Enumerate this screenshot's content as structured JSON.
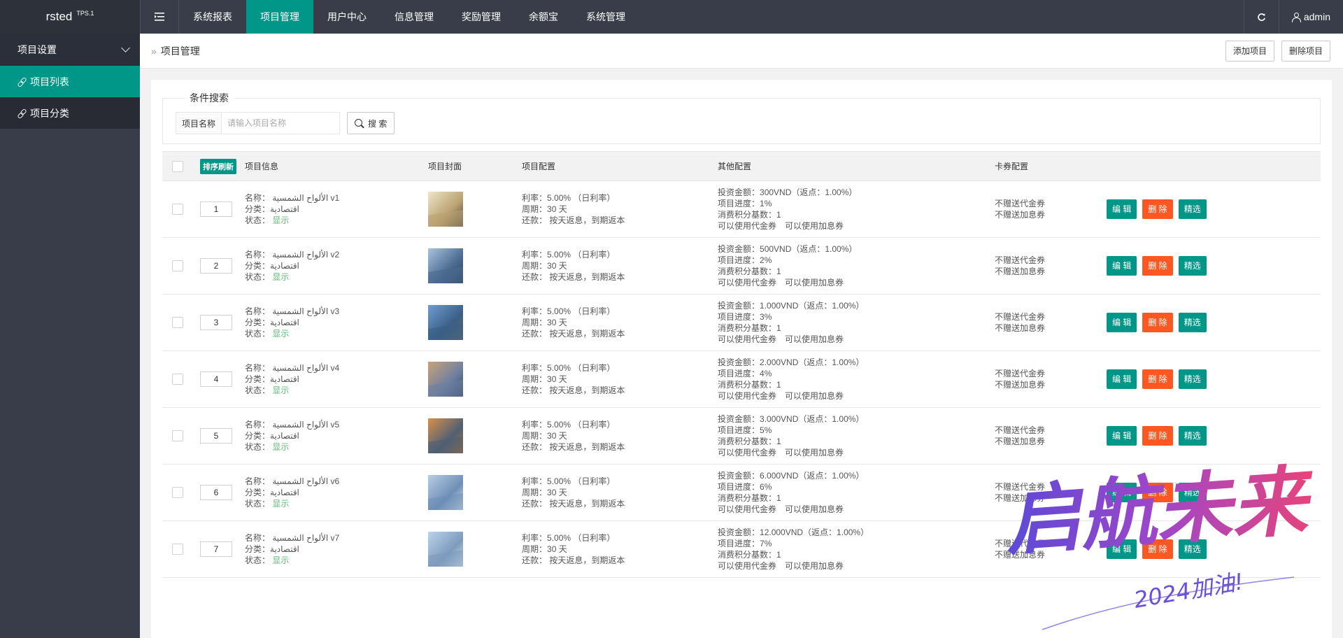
{
  "brand": {
    "name": "rsted",
    "version": "TPS.1"
  },
  "topnav": {
    "items": [
      {
        "label": "系统报表",
        "active": false
      },
      {
        "label": "项目管理",
        "active": true
      },
      {
        "label": "用户中心",
        "active": false
      },
      {
        "label": "信息管理",
        "active": false
      },
      {
        "label": "奖励管理",
        "active": false
      },
      {
        "label": "余额宝",
        "active": false
      },
      {
        "label": "系统管理",
        "active": false
      }
    ],
    "user": "admin",
    "refresh_icon": "refresh-icon"
  },
  "sidebar": {
    "group": "项目设置",
    "items": [
      {
        "label": "项目列表",
        "active": true
      },
      {
        "label": "项目分类",
        "active": false
      }
    ]
  },
  "breadcrumb": {
    "sep": "»",
    "title": "项目管理",
    "add_label": "添加项目",
    "delete_label": "删除项目"
  },
  "search": {
    "legend": "条件搜索",
    "label": "项目名称",
    "placeholder": "请输入项目名称",
    "button": "搜 索"
  },
  "table": {
    "headers": {
      "sort_button": "排序刷新",
      "info": "项目信息",
      "cover": "项目封面",
      "config": "项目配置",
      "other": "其他配置",
      "coupon": "卡券配置"
    },
    "field_labels": {
      "name": "名称：",
      "category": "分类：",
      "status": "状态：",
      "rate": "利率：",
      "period": "周期：",
      "repay": "还款：",
      "amount": "投资金额：",
      "progress": "项目进度：",
      "points": "消费积分基数："
    },
    "actions": {
      "edit": "编 辑",
      "delete": "删 除",
      "pick": "精选"
    },
    "rows": [
      {
        "sort": "1",
        "name": "الألواح الشمسية v1",
        "category": "اقتصادية",
        "status": "显示",
        "rate": "5.00% （日利率）",
        "period": "30 天",
        "repay": "按天返息，到期返本",
        "amount": "300VND（返点：1.00%）",
        "progress": "1%",
        "points": "1",
        "use": "可以使用代金券　可以使用加息券",
        "coupon1": "不赠送代金券",
        "coupon2": "不赠送加息券",
        "thumb": [
          "#f0e6c8",
          "#b9a070",
          "#3a3a3a"
        ]
      },
      {
        "sort": "2",
        "name": "الألواح الشمسية v2",
        "category": "اقتصادية",
        "status": "显示",
        "rate": "5.00% （日利率）",
        "period": "30 天",
        "repay": "按天返息，到期返本",
        "amount": "500VND（返点：1.00%）",
        "progress": "2%",
        "points": "1",
        "use": "可以使用代金券　可以使用加息券",
        "coupon1": "不赠送代金券",
        "coupon2": "不赠送加息券",
        "thumb": [
          "#a8c4e0",
          "#4a6a8f",
          "#2c3e55"
        ]
      },
      {
        "sort": "3",
        "name": "الألواح الشمسية v3",
        "category": "اقتصادية",
        "status": "显示",
        "rate": "5.00% （日利率）",
        "period": "30 天",
        "repay": "按天返息，到期返本",
        "amount": "1.000VND（返点：1.00%）",
        "progress": "3%",
        "points": "1",
        "use": "可以使用代金券　可以使用加息券",
        "coupon1": "不赠送代金券",
        "coupon2": "不赠送加息券",
        "thumb": [
          "#6f9dd1",
          "#3b5f86",
          "#6b6b6b"
        ]
      },
      {
        "sort": "4",
        "name": "الألواح الشمسية v4",
        "category": "اقتصادية",
        "status": "显示",
        "rate": "5.00% （日利率）",
        "period": "30 天",
        "repay": "按天返息，到期返本",
        "amount": "2.000VND（返点：1.00%）",
        "progress": "4%",
        "points": "1",
        "use": "可以使用代金券　可以使用加息券",
        "coupon1": "不赠送代金券",
        "coupon2": "不赠送加息券",
        "thumb": [
          "#c9a27a",
          "#6d7fa0",
          "#2f3f5f"
        ]
      },
      {
        "sort": "5",
        "name": "الألواح الشمسية v5",
        "category": "اقتصادية",
        "status": "显示",
        "rate": "5.00% （日利率）",
        "period": "30 天",
        "repay": "按天返息，到期返本",
        "amount": "3.000VND（返点：1.00%）",
        "progress": "5%",
        "points": "1",
        "use": "可以使用代金券　可以使用加息券",
        "coupon1": "不赠送代金券",
        "coupon2": "不赠送加息券",
        "thumb": [
          "#d9904a",
          "#4f5f73",
          "#b8752e"
        ]
      },
      {
        "sort": "6",
        "name": "الألواح الشمسية v6",
        "category": "اقتصادية",
        "status": "显示",
        "rate": "5.00% （日利率）",
        "period": "30 天",
        "repay": "按天返息，到期返本",
        "amount": "6.000VND（返点：1.00%）",
        "progress": "6%",
        "points": "1",
        "use": "可以使用代金券　可以使用加息券",
        "coupon1": "不赠送代金券",
        "coupon2": "不赠送加息券",
        "thumb": [
          "#b6cde6",
          "#6e8fb5",
          "#e4eef7"
        ]
      },
      {
        "sort": "7",
        "name": "الألواح الشمسية v7",
        "category": "اقتصادية",
        "status": "显示",
        "rate": "5.00% （日利率）",
        "period": "30 天",
        "repay": "按天返息，到期返本",
        "amount": "12.000VND（返点：1.00%）",
        "progress": "7%",
        "points": "1",
        "use": "可以使用代金券　可以使用加息券",
        "coupon1": "不赠送代金券",
        "coupon2": "不赠送加息券",
        "thumb": [
          "#bcd3ea",
          "#7d9bbd",
          "#dfe9f3"
        ]
      }
    ]
  },
  "watermark": {
    "text": "启航未来",
    "sub": "2024加油!"
  },
  "colors": {
    "accent": "#009688",
    "danger": "#ff5722",
    "header": "#393d49",
    "status_on": "#5fb878"
  }
}
